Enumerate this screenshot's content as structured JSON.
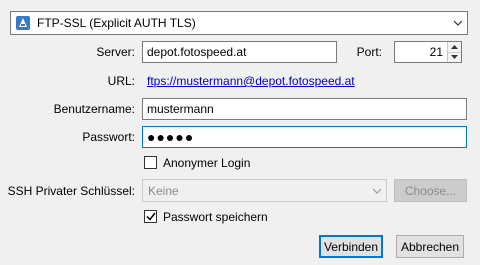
{
  "protocol": {
    "selected": "FTP-SSL (Explicit AUTH TLS)",
    "icon": "ftp-server-icon"
  },
  "server": {
    "label": "Server:",
    "value": "depot.fotospeed.at"
  },
  "port": {
    "label": "Port:",
    "value": "21"
  },
  "url": {
    "label": "URL:",
    "value": "ftps://mustermann@depot.fotospeed.at"
  },
  "username": {
    "label": "Benutzername:",
    "value": "mustermann"
  },
  "password": {
    "label": "Passwort:",
    "value": "●●●●●"
  },
  "anonymous": {
    "label": "Anonymer Login",
    "checked": false
  },
  "ssh_key": {
    "label": "SSH Privater Schlüssel:",
    "selected": "Keine",
    "choose_label": "Choose...",
    "enabled": false
  },
  "save_password": {
    "label": "Passwort speichern",
    "checked": true
  },
  "buttons": {
    "connect": "Verbinden",
    "cancel": "Abbrechen"
  },
  "colors": {
    "accent": "#0078d7",
    "link": "#0000cc"
  }
}
